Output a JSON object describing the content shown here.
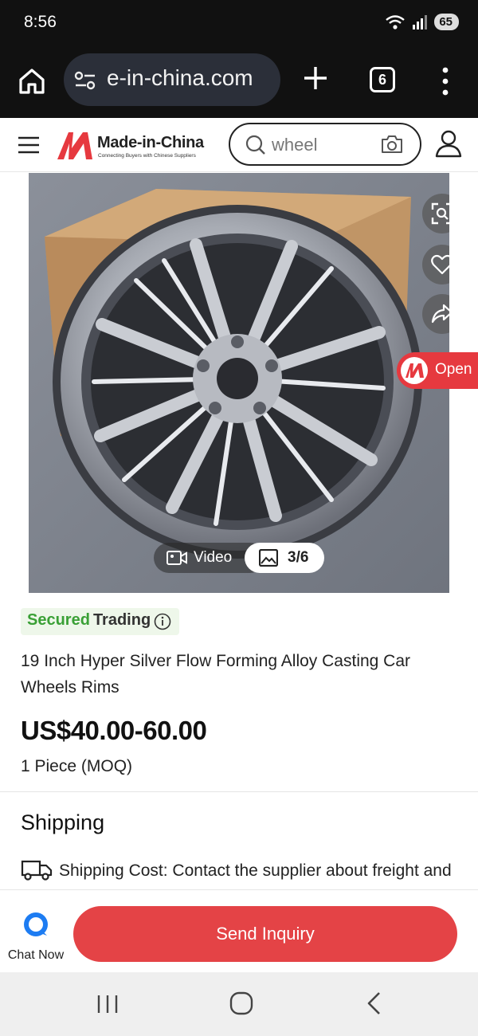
{
  "status_bar": {
    "time": "8:56",
    "battery": "65"
  },
  "browser": {
    "url": "e-in-china.com",
    "tab_count": "6"
  },
  "site_header": {
    "brand": "Made-in-China",
    "tagline": "Connecting Buyers with Chinese Suppliers",
    "search_query": "wheel"
  },
  "gallery": {
    "open_label": "Open",
    "video_label": "Video",
    "photo_counter": "3/6"
  },
  "product": {
    "secured_a": "Secured",
    "secured_b": "Trading",
    "title": "19 Inch Hyper Silver Flow Forming Alloy Casting Car Wheels Rims",
    "price": "US$40.00-60.00",
    "moq": "1 Piece (MOQ)"
  },
  "shipping": {
    "heading": "Shipping",
    "cost_text": "Shipping Cost: Contact the supplier about freight and estimated delivery time."
  },
  "actions": {
    "chat_label": "Chat Now",
    "inquiry_label": "Send Inquiry"
  },
  "colors": {
    "brand_red": "#e44346",
    "secured_green": "#3aa036",
    "browser_dark": "#111111"
  }
}
